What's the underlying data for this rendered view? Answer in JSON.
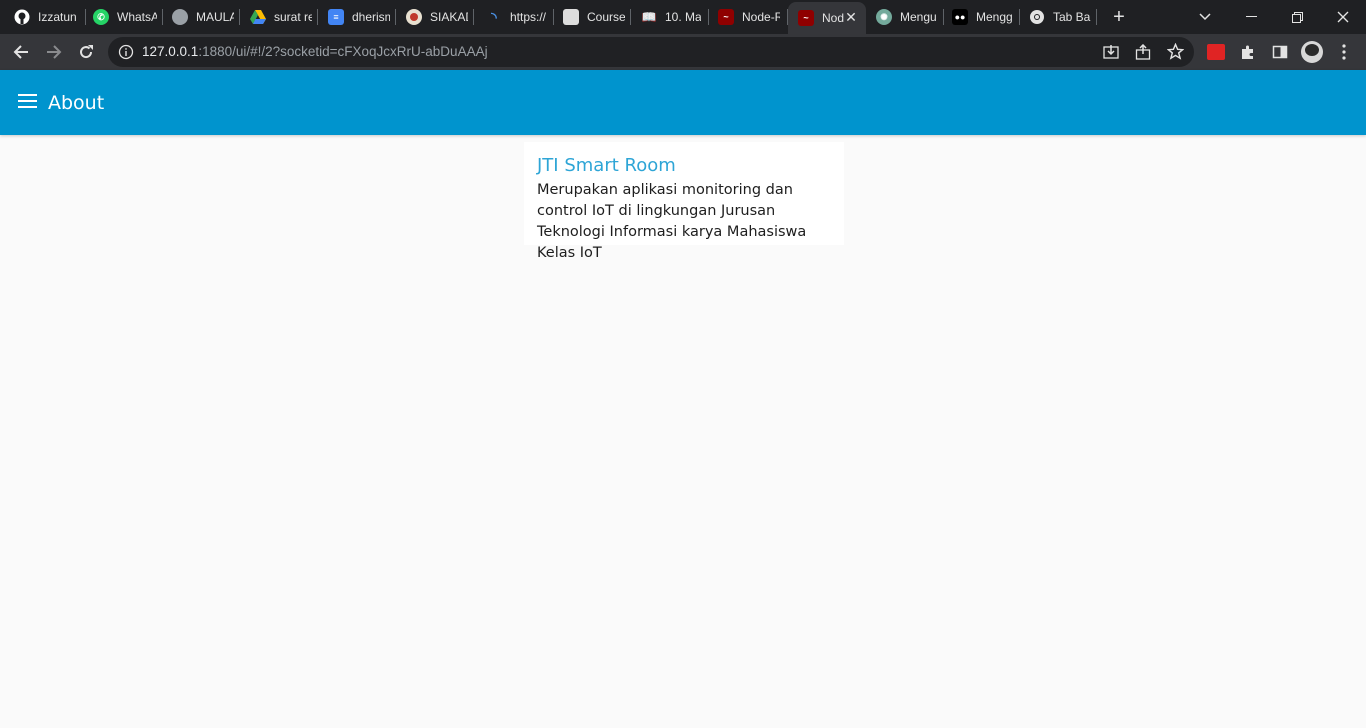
{
  "browser": {
    "tabs": [
      {
        "title": "Izzatun",
        "icon": "github-icon",
        "color": "#ffffff"
      },
      {
        "title": "WhatsApp",
        "icon": "whatsapp-icon",
        "color": "#25d366"
      },
      {
        "title": "MAULANA",
        "icon": "globe-icon",
        "color": "#9aa0a6"
      },
      {
        "title": "surat re",
        "icon": "google-drive-icon",
        "color": "#34a853"
      },
      {
        "title": "dherism",
        "icon": "google-docs-icon",
        "color": "#4285f4"
      },
      {
        "title": "SIAKAD",
        "icon": "university-logo-icon",
        "color": "#c0392b"
      },
      {
        "title": "https://",
        "icon": "loading-icon",
        "color": "#4a90e2"
      },
      {
        "title": "Course",
        "icon": "course-icon",
        "color": "#dddddd"
      },
      {
        "title": "10. Ma",
        "icon": "book-icon",
        "color": "#e3e3e3"
      },
      {
        "title": "Node-RED",
        "icon": "node-red-icon",
        "color": "#8f0000"
      },
      {
        "title": "Node-RED Dashboard",
        "icon": "node-red-icon",
        "color": "#8f0000",
        "active": true
      },
      {
        "title": "Mengu",
        "icon": "chatgpt-icon",
        "color": "#74aa9c"
      },
      {
        "title": "Mengg",
        "icon": "medium-icon",
        "color": "#000000"
      },
      {
        "title": "Tab Baru",
        "icon": "chrome-icon",
        "color": "#e3e3e3"
      }
    ],
    "url_host": "127.0.0.1",
    "url_rest": ":1880/ui/#!/2?socketid=cFXoqJcxRrU-abDuAAAj"
  },
  "app": {
    "header_title": "About",
    "accent_color": "#0094ce"
  },
  "card": {
    "title": "JTI Smart Room",
    "body": "Merupakan aplikasi monitoring dan control IoT di lingkungan Jurusan Teknologi Informasi karya Mahasiswa Kelas IoT"
  }
}
